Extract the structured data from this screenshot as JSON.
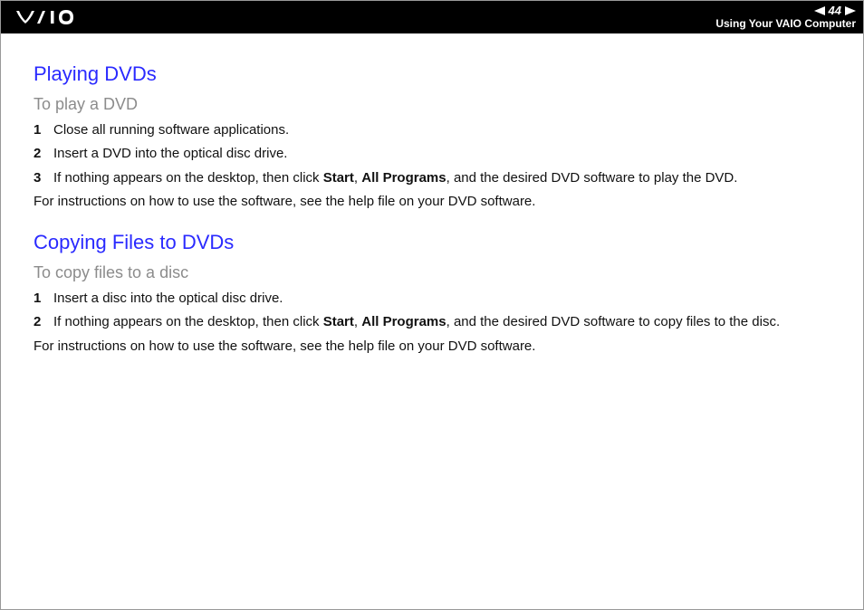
{
  "header": {
    "page_number": "44",
    "section_title": "Using Your VAIO Computer"
  },
  "section1": {
    "heading": "Playing DVDs",
    "subheading": "To play a DVD",
    "steps": [
      {
        "num": "1",
        "text": "Close all running software applications."
      },
      {
        "num": "2",
        "text": "Insert a DVD into the optical disc drive."
      },
      {
        "num": "3",
        "prefix": "If nothing appears on the desktop, then click ",
        "bold1": "Start",
        "sep1": ", ",
        "bold2": "All Programs",
        "suffix": ", and the desired DVD software to play the DVD."
      }
    ],
    "footer": "For instructions on how to use the software, see the help file on your DVD software."
  },
  "section2": {
    "heading": "Copying Files to DVDs",
    "subheading": "To copy files to a disc",
    "steps": [
      {
        "num": "1",
        "text": "Insert a disc into the optical disc drive."
      },
      {
        "num": "2",
        "prefix": "If nothing appears on the desktop, then click ",
        "bold1": "Start",
        "sep1": ", ",
        "bold2": "All Programs",
        "suffix": ", and the desired DVD software to copy files to the disc."
      }
    ],
    "footer": "For instructions on how to use the software, see the help file on your DVD software."
  }
}
